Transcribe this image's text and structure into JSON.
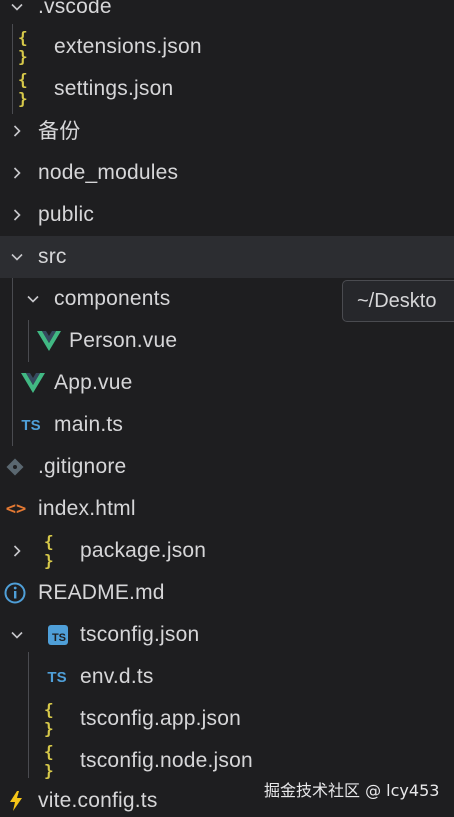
{
  "tree": {
    "items": [
      {
        "label": ".vscode",
        "icon": "chevron-down-icon"
      },
      {
        "label": "extensions.json",
        "icon": "{ }"
      },
      {
        "label": "settings.json",
        "icon": "{ }"
      },
      {
        "label": "备份",
        "icon": "chevron-right-icon"
      },
      {
        "label": "node_modules",
        "icon": "chevron-right-icon"
      },
      {
        "label": "public",
        "icon": "chevron-right-icon"
      },
      {
        "label": "src",
        "icon": "chevron-down-icon"
      },
      {
        "label": "components",
        "icon": "chevron-down-icon"
      },
      {
        "label": "Person.vue",
        "icon": "vue-icon"
      },
      {
        "label": "App.vue",
        "icon": "vue-icon"
      },
      {
        "label": "main.ts",
        "icon": "TS"
      },
      {
        "label": ".gitignore",
        "icon": "git-icon"
      },
      {
        "label": "index.html",
        "icon": "<>"
      },
      {
        "label": "package.json",
        "icon": "{ }"
      },
      {
        "label": "README.md",
        "icon": "info-icon"
      },
      {
        "label": "tsconfig.json",
        "icon": "TS"
      },
      {
        "label": "env.d.ts",
        "icon": "TS"
      },
      {
        "label": "tsconfig.app.json",
        "icon": "{ }"
      },
      {
        "label": "tsconfig.node.json",
        "icon": "{ }"
      },
      {
        "label": "vite.config.ts",
        "icon": "vite-icon"
      }
    ]
  },
  "tooltip": {
    "text": "~/Deskto"
  },
  "watermark": {
    "text": "掘金技术社区 @ lcy453"
  },
  "colors": {
    "background": "#1e1e20",
    "selected_row": "#2c2d31",
    "json_icon": "#d7c94a",
    "ts_icon": "#4f9fd8",
    "vue_green": "#41b883",
    "html_orange": "#e37933",
    "vite_yellow": "#f5c518"
  }
}
